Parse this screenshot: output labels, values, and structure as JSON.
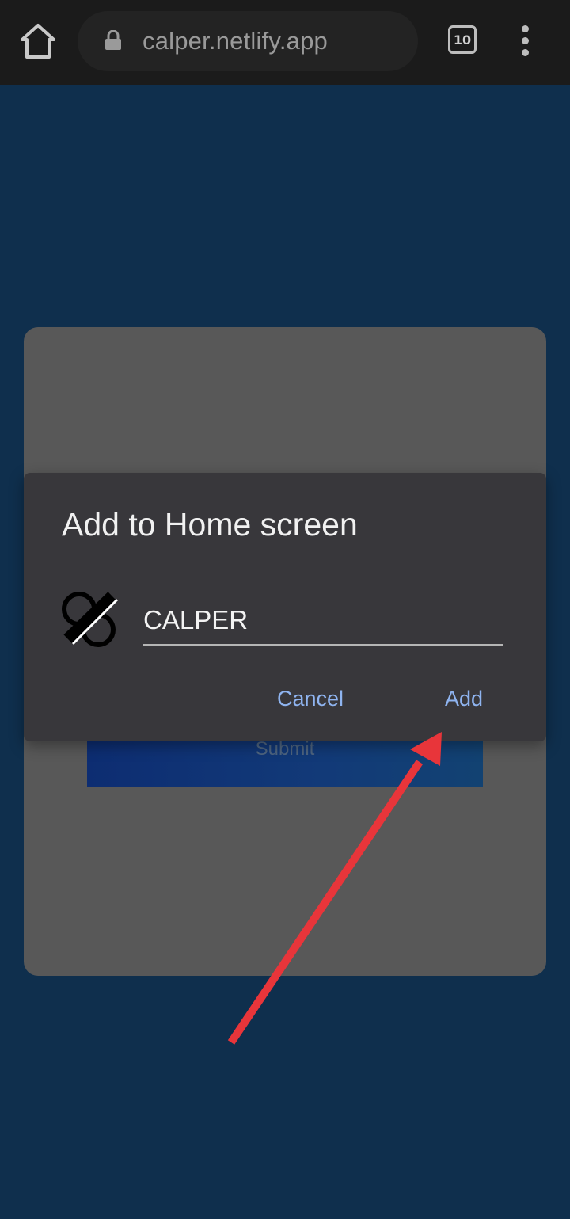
{
  "browser": {
    "url": "calper.netlify.app",
    "tab_count": "10",
    "icons": {
      "home": "home-icon",
      "lock": "lock-icon",
      "tabs": "tabs-icon",
      "menu": "more-vert-icon"
    }
  },
  "page": {
    "submit_label": "Submit"
  },
  "dialog": {
    "title": "Add to Home screen",
    "app_name": "CALPER",
    "cancel_label": "Cancel",
    "add_label": "Add"
  },
  "colors": {
    "page_background": "#0f2f4d",
    "dialog_background": "#38373b",
    "accent_text": "#8fb4f0",
    "annotation_arrow": "#e8353a"
  }
}
